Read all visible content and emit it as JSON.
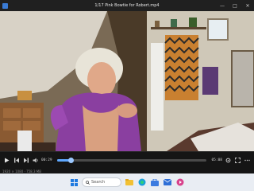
{
  "window": {
    "title": "1/17 Pink Bowtie for Robert.mp4"
  },
  "player": {
    "time_current": "00:29",
    "time_total": "05:08",
    "progress": 0.095,
    "status_left": "1920 × 1080 · 758.3 MB"
  },
  "taskbar": {
    "search_placeholder": "Search",
    "clock_time": "",
    "clock_date": ""
  },
  "colors": {
    "accent": "#5fa8ff",
    "titlebar": "#202020",
    "controlbar": "#151515",
    "taskbar": "#e9edf3"
  },
  "icons": [
    "app-icon",
    "minimize-icon",
    "maximize-icon",
    "close-icon",
    "play-icon",
    "skip-back-icon",
    "skip-forward-icon",
    "volume-icon",
    "settings-icon",
    "fullscreen-icon",
    "more-icon",
    "windows-start-icon",
    "search-icon",
    "file-explorer-icon",
    "browser-icon",
    "store-icon",
    "mail-icon",
    "media-player-icon"
  ]
}
